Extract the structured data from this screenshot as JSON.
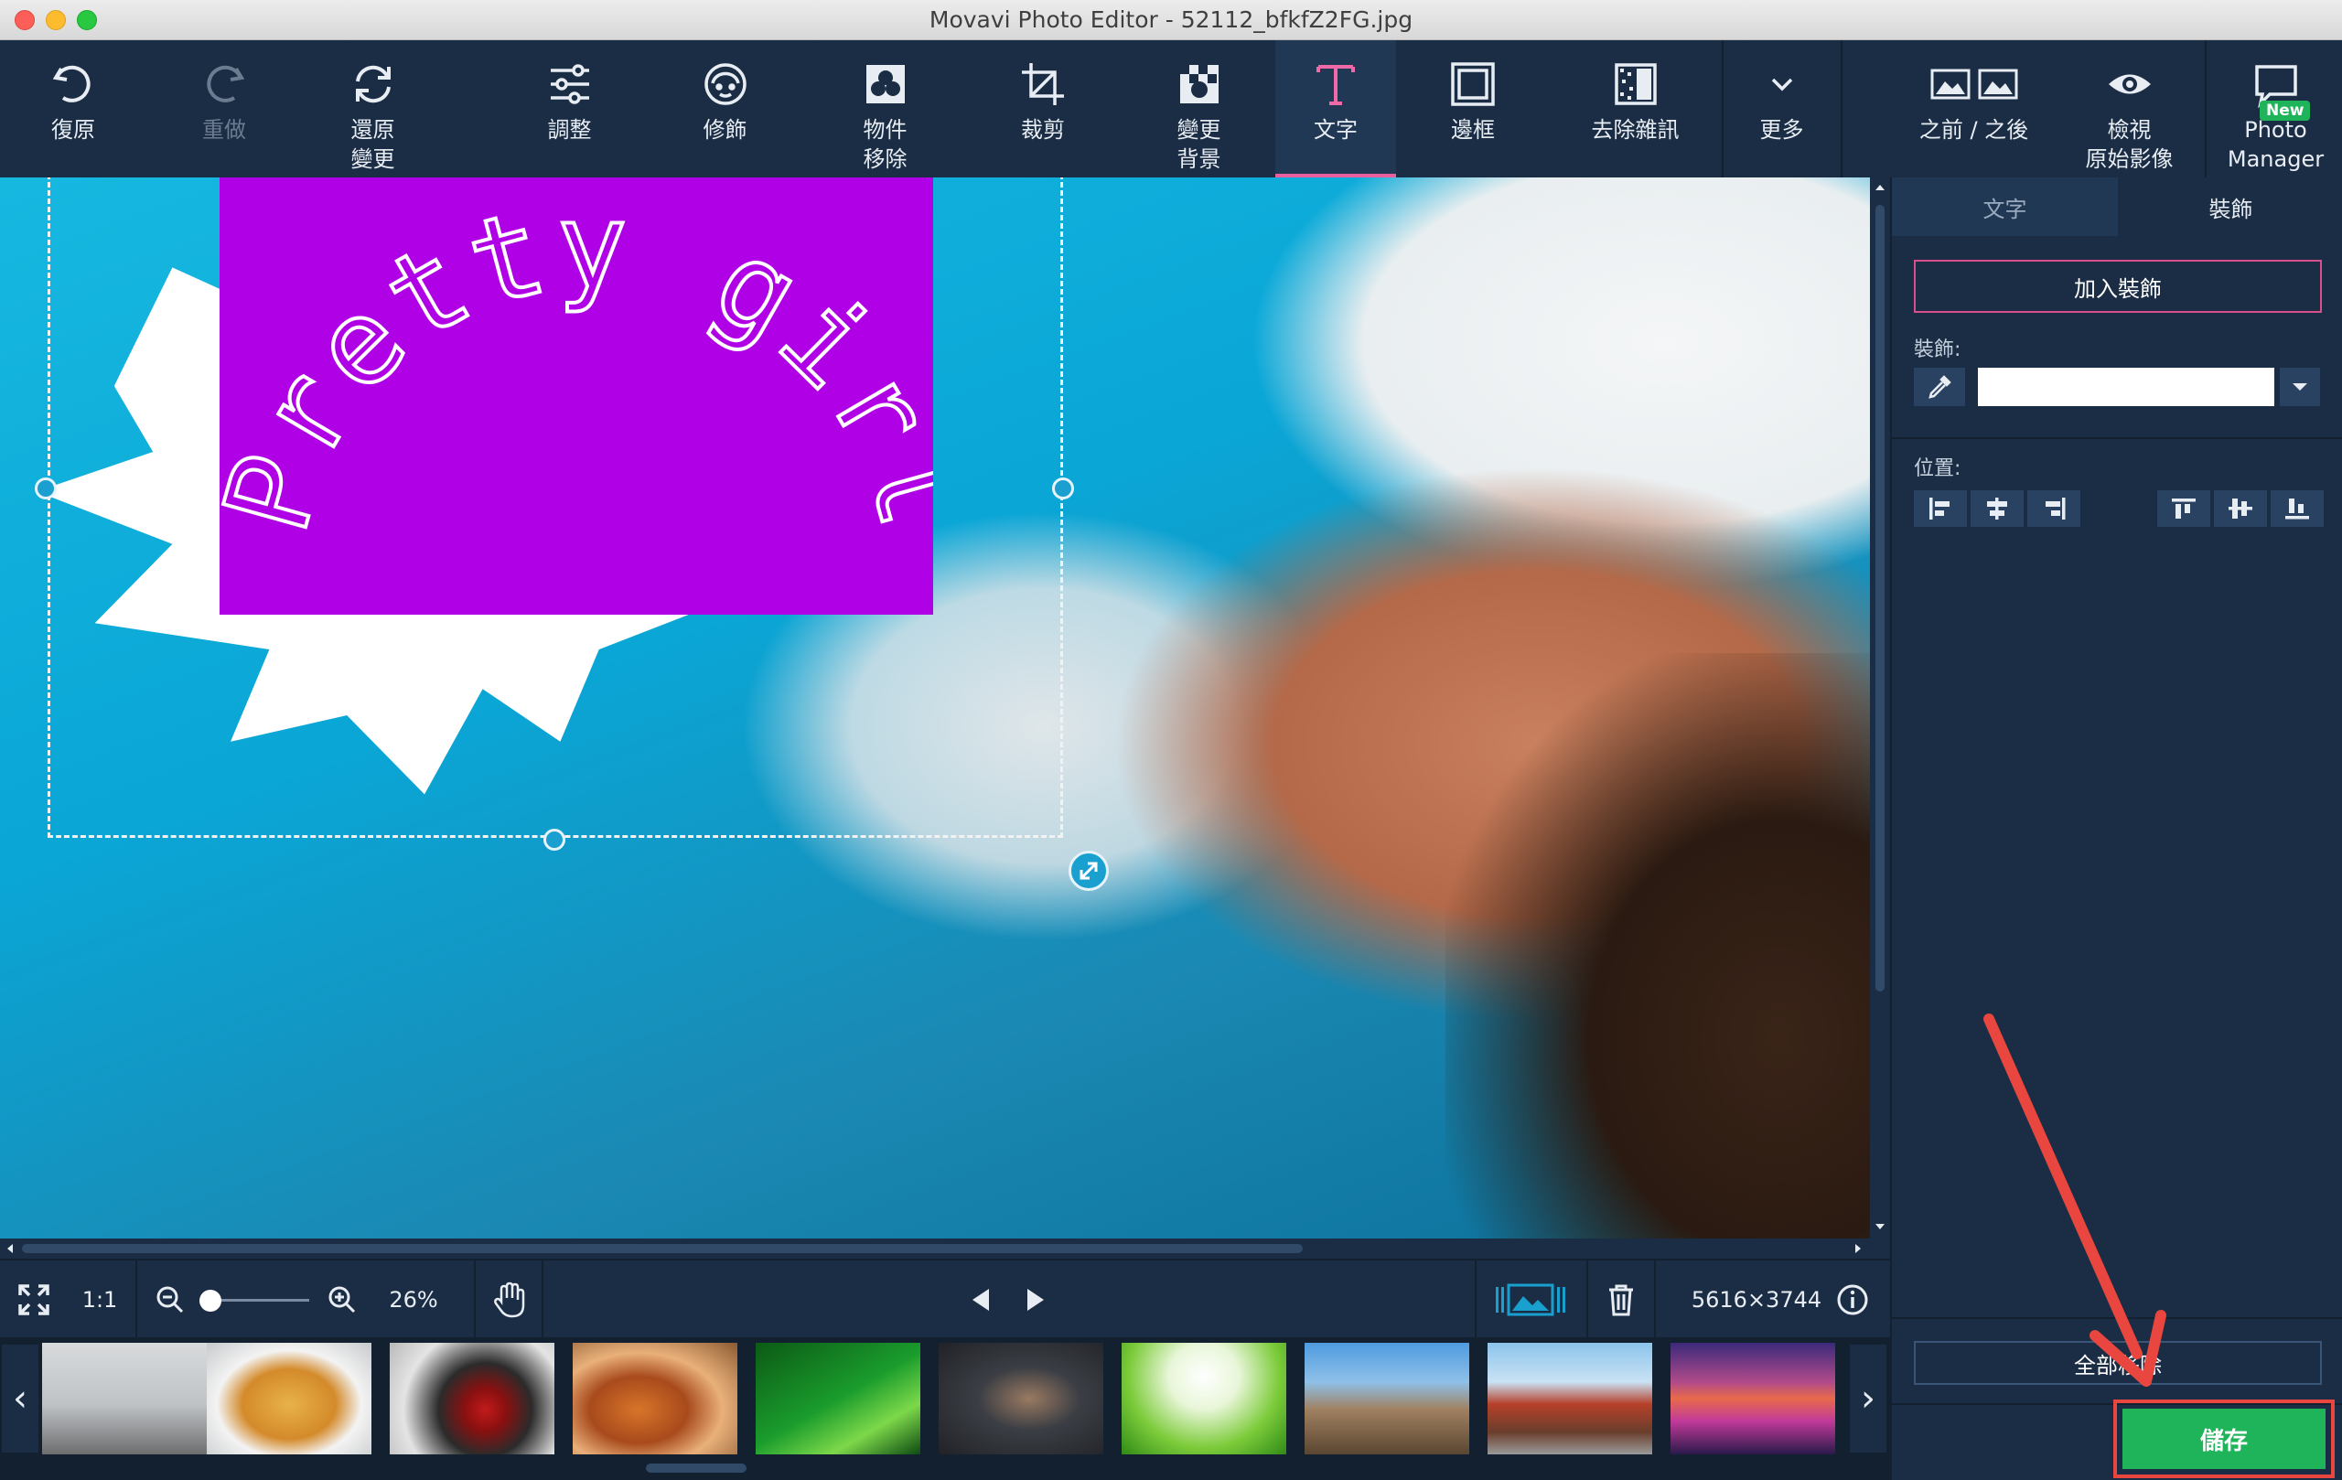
{
  "window": {
    "title": "Movavi Photo Editor - 52112_bfkfZ2FG.jpg"
  },
  "toolbar": {
    "undo": "復原",
    "redo": "重做",
    "restore_line1": "還原",
    "restore_line2": "變更",
    "adjust": "調整",
    "retouch": "修飾",
    "object_removal_line1": "物件",
    "object_removal_line2": "移除",
    "crop": "裁剪",
    "change_bg_line1": "變更",
    "change_bg_line2": "背景",
    "text": "文字",
    "frames": "邊框",
    "denoise": "去除雜訊",
    "more": "更多",
    "before_after": "之前 / 之後",
    "view_original_line1": "檢視",
    "view_original_line2": "原始影像",
    "photo_manager_line1": "Photo",
    "photo_manager_line2": "Manager",
    "new_badge": "New"
  },
  "canvas": {
    "caption_text": "Pretty girl"
  },
  "bottombar": {
    "one_to_one": "1:1",
    "zoom_percent": "26%",
    "zoom_level": 0.26,
    "image_size": "5616×3744"
  },
  "panel": {
    "tab_text": "文字",
    "tab_decoration": "裝飾",
    "add_decoration": "加入裝飾",
    "decoration_label": "裝飾:",
    "position_label": "位置:",
    "delete_all": "全部移除",
    "save": "儲存"
  },
  "filmstrip": {
    "thumbnails": [
      {
        "subject": "workout"
      },
      {
        "subject": "pasta"
      },
      {
        "subject": "wedding-rose"
      },
      {
        "subject": "food-table"
      },
      {
        "subject": "green-drops"
      },
      {
        "subject": "dumbbells"
      },
      {
        "subject": "green-leaves"
      },
      {
        "subject": "rocky-coast"
      },
      {
        "subject": "chinese-tower"
      },
      {
        "subject": "flower-field"
      }
    ]
  },
  "colors": {
    "bg": "#1b2d44",
    "accent_pink": "#e95fa0",
    "save_green": "#1fb35a",
    "highlight_red": "#e8463f",
    "caption_bg": "#b000e6"
  }
}
